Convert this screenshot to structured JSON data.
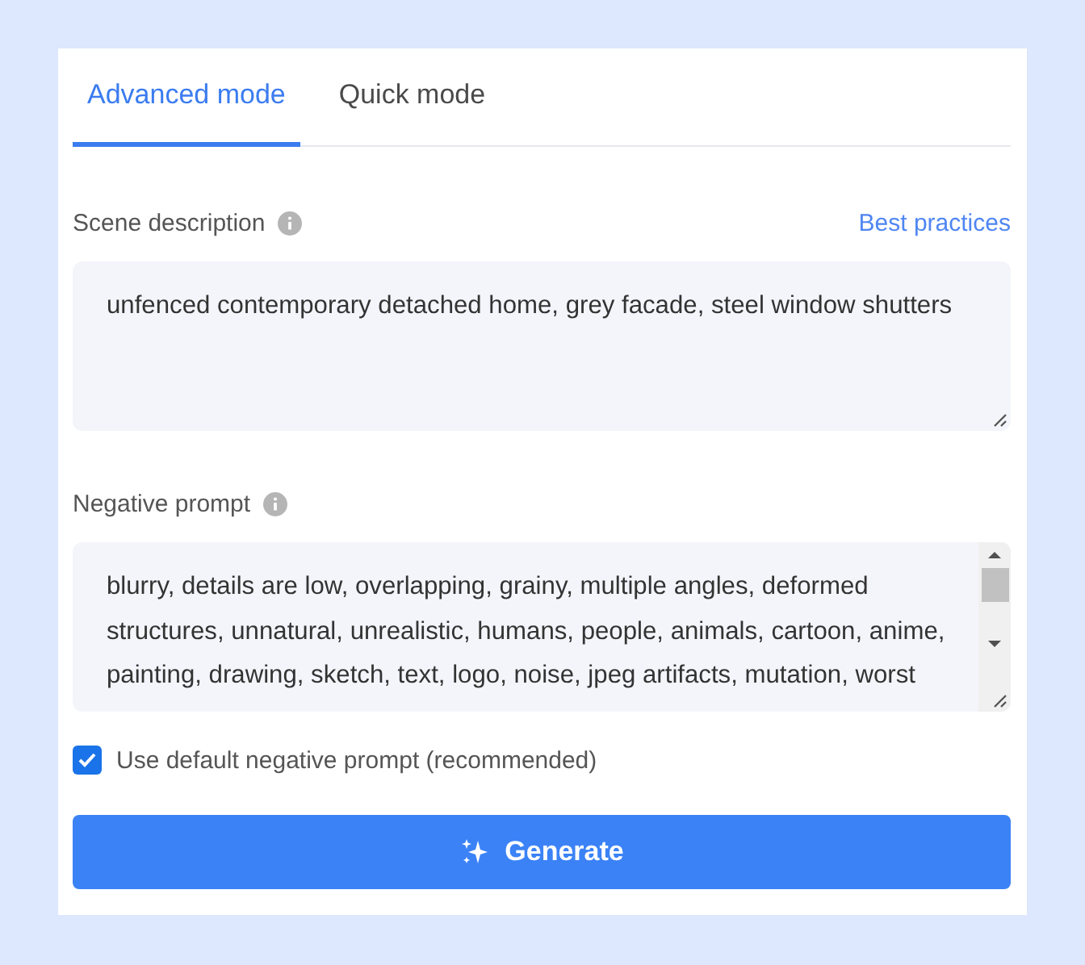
{
  "tabs": [
    {
      "label": "Advanced mode",
      "selected": true
    },
    {
      "label": "Quick mode",
      "selected": false
    }
  ],
  "scene_description": {
    "label": "Scene description",
    "link": "Best practices",
    "value": "unfenced contemporary detached home, grey facade, steel window shutters"
  },
  "negative_prompt": {
    "label": "Negative prompt",
    "value": "blurry, details are low, overlapping, grainy, multiple angles, deformed structures, unnatural, unrealistic, humans, people, animals, cartoon, anime, painting, drawing, sketch, text, logo, noise, jpeg artifacts, mutation, worst"
  },
  "default_negative": {
    "label": "Use default negative prompt (recommended)",
    "checked": true
  },
  "generate_button": {
    "label": "Generate"
  }
}
